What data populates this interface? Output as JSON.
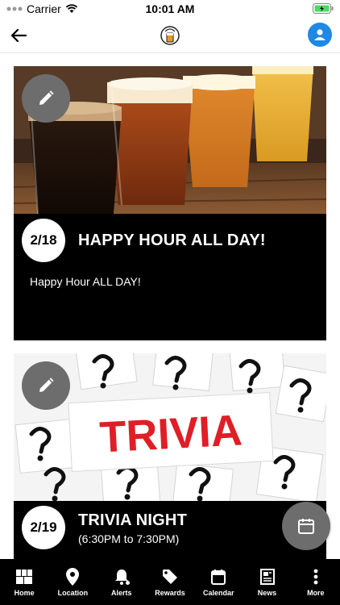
{
  "status_bar": {
    "carrier": "Carrier",
    "time": "10:01 AM"
  },
  "nav": {
    "back_icon": "back-arrow-icon",
    "logo_icon": "brewery-logo-icon",
    "profile_icon": "user-icon"
  },
  "events": [
    {
      "date": "2/18",
      "title": "HAPPY HOUR ALL DAY!",
      "description": "Happy Hour ALL DAY!"
    },
    {
      "date": "2/19",
      "title": "TRIVIA NIGHT",
      "subtitle": "(6:30PM to 7:30PM)",
      "image_text": "TRIVIA"
    }
  ],
  "tabs": [
    {
      "label": "Home",
      "icon": "grid-icon"
    },
    {
      "label": "Location",
      "icon": "pin-icon"
    },
    {
      "label": "Alerts",
      "icon": "bell-icon"
    },
    {
      "label": "Rewards",
      "icon": "tag-icon"
    },
    {
      "label": "Calendar",
      "icon": "calendar-icon"
    },
    {
      "label": "News",
      "icon": "newspaper-icon"
    },
    {
      "label": "More",
      "icon": "more-icon"
    }
  ],
  "colors": {
    "accent": "#1e88e5",
    "card_bg": "#000000",
    "fab_bg": "#6d6d6d",
    "tab_bar_bg": "#000000"
  }
}
